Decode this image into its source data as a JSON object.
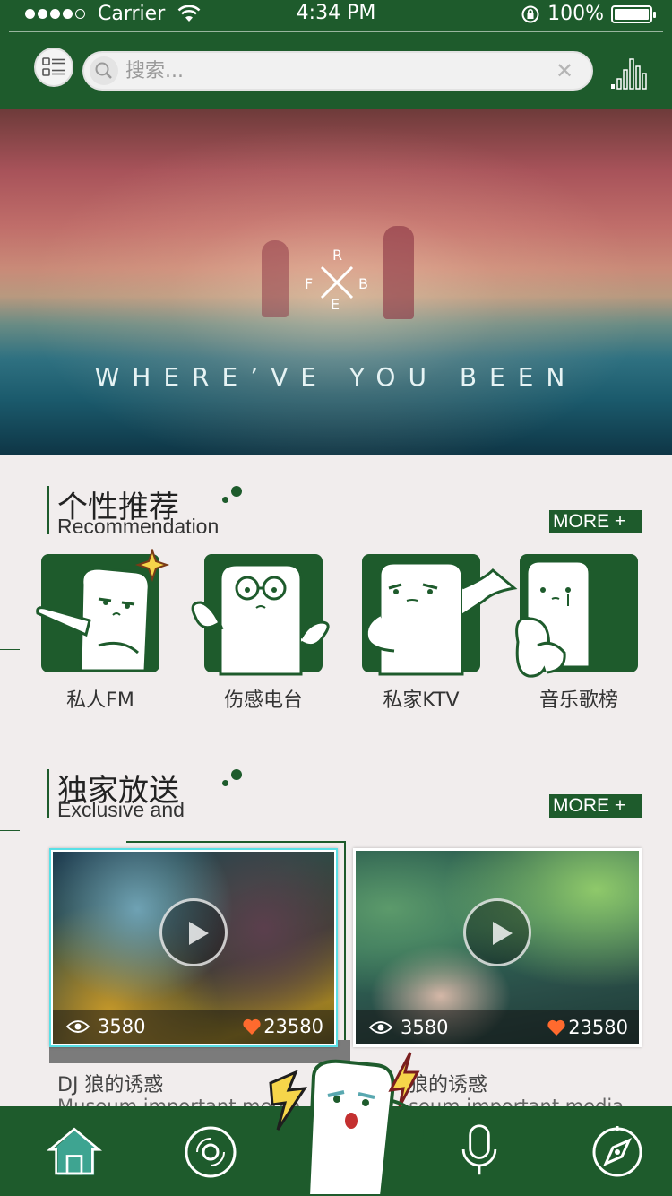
{
  "status_bar": {
    "carrier": "Carrier",
    "time": "4:34 PM",
    "battery": "100%"
  },
  "search": {
    "placeholder": "搜索..."
  },
  "banner": {
    "logo_letters": {
      "top": "R",
      "left": "F",
      "right": "B",
      "bottom": "E"
    },
    "title": "WHERE’VE YOU BEEN"
  },
  "recommend": {
    "title": "个性推荐",
    "subtitle": "Recommendation",
    "more": "MORE +",
    "items": [
      {
        "label": "私人FM"
      },
      {
        "label": "伤感电台"
      },
      {
        "label": "私家KTV"
      },
      {
        "label": "音乐歌榜"
      }
    ]
  },
  "exclusive": {
    "title": "独家放送",
    "subtitle": "Exclusive and",
    "more": "MORE +",
    "cards": [
      {
        "views": "3580",
        "likes": "23580",
        "caption": "DJ   狼的诱惑",
        "caption2": "Museum important media"
      },
      {
        "views": "3580",
        "likes": "23580",
        "caption": "狼的诱惑",
        "caption2": "seum important media"
      }
    ]
  },
  "tabs": [
    "home-icon",
    "disc-icon",
    "mic-icon",
    "compass-icon"
  ],
  "colors": {
    "brand_green": "#1e5b2c",
    "like_orange": "#ff6a2e",
    "highlight_cyan": "#59e0e6"
  }
}
